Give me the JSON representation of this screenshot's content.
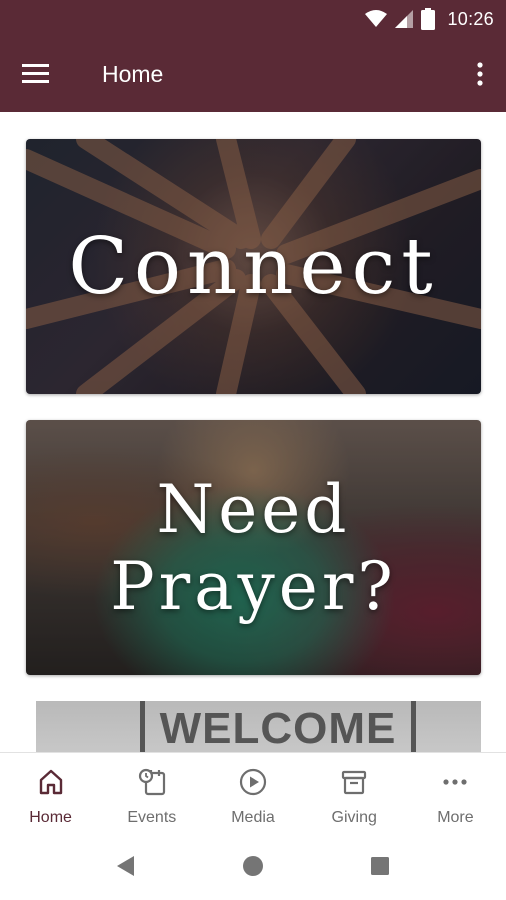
{
  "status_bar": {
    "time": "10:26",
    "icons": [
      "wifi-icon",
      "signal-icon",
      "battery-icon"
    ]
  },
  "app_bar": {
    "title": "Home",
    "menu_icon": "hamburger-menu-icon",
    "overflow_icon": "more-vert-icon",
    "color": "#5a2a36"
  },
  "cards": [
    {
      "title": "Connect",
      "image": "hands-together-photo"
    },
    {
      "title": "Need Prayer?",
      "image": "people-praying-photo"
    },
    {
      "title": "WELCOME",
      "image": "welcome-sign-photo"
    }
  ],
  "bottom_nav": {
    "items": [
      {
        "label": "Home",
        "icon": "home-icon",
        "active": true
      },
      {
        "label": "Events",
        "icon": "events-calendar-icon",
        "active": false
      },
      {
        "label": "Media",
        "icon": "play-circle-icon",
        "active": false
      },
      {
        "label": "Giving",
        "icon": "archive-box-icon",
        "active": false
      },
      {
        "label": "More",
        "icon": "more-horiz-icon",
        "active": false
      }
    ],
    "active_color": "#5a2a36",
    "inactive_color": "#6e6e6e"
  },
  "system_nav": {
    "icons": [
      "back-icon",
      "home-circle-icon",
      "recents-icon"
    ]
  }
}
